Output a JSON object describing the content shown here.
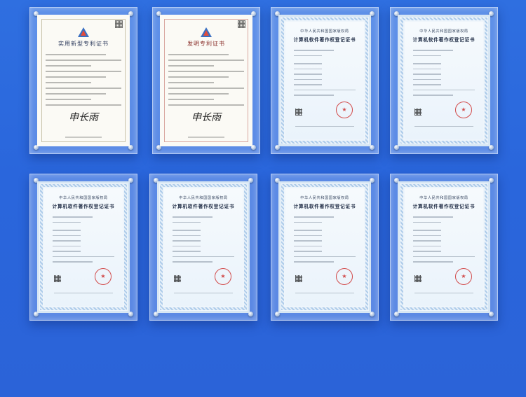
{
  "certificates": [
    {
      "kind": "utility-patent",
      "title": "实用新型专利证书",
      "signature": "申长雨"
    },
    {
      "kind": "invention-patent",
      "title": "发明专利证书",
      "signature": "申长雨"
    },
    {
      "kind": "software-copyright",
      "authority": "中华人民共和国国家版权局",
      "title": "计算机软件著作权登记证书"
    },
    {
      "kind": "software-copyright",
      "authority": "中华人民共和国国家版权局",
      "title": "计算机软件著作权登记证书"
    },
    {
      "kind": "software-copyright",
      "authority": "中华人民共和国国家版权局",
      "title": "计算机软件著作权登记证书"
    },
    {
      "kind": "software-copyright",
      "authority": "中华人民共和国国家版权局",
      "title": "计算机软件著作权登记证书"
    },
    {
      "kind": "software-copyright",
      "authority": "中华人民共和国国家版权局",
      "title": "计算机软件著作权登记证书"
    },
    {
      "kind": "software-copyright",
      "authority": "中华人民共和国国家版权局",
      "title": "计算机软件著作权登记证书"
    }
  ],
  "colors": {
    "background": "#2b66dc",
    "frame_glass": "#dcebff",
    "patent_title": "#2c3a5c",
    "invention_title": "#8a2f2a",
    "seal": "#d24a4a"
  }
}
